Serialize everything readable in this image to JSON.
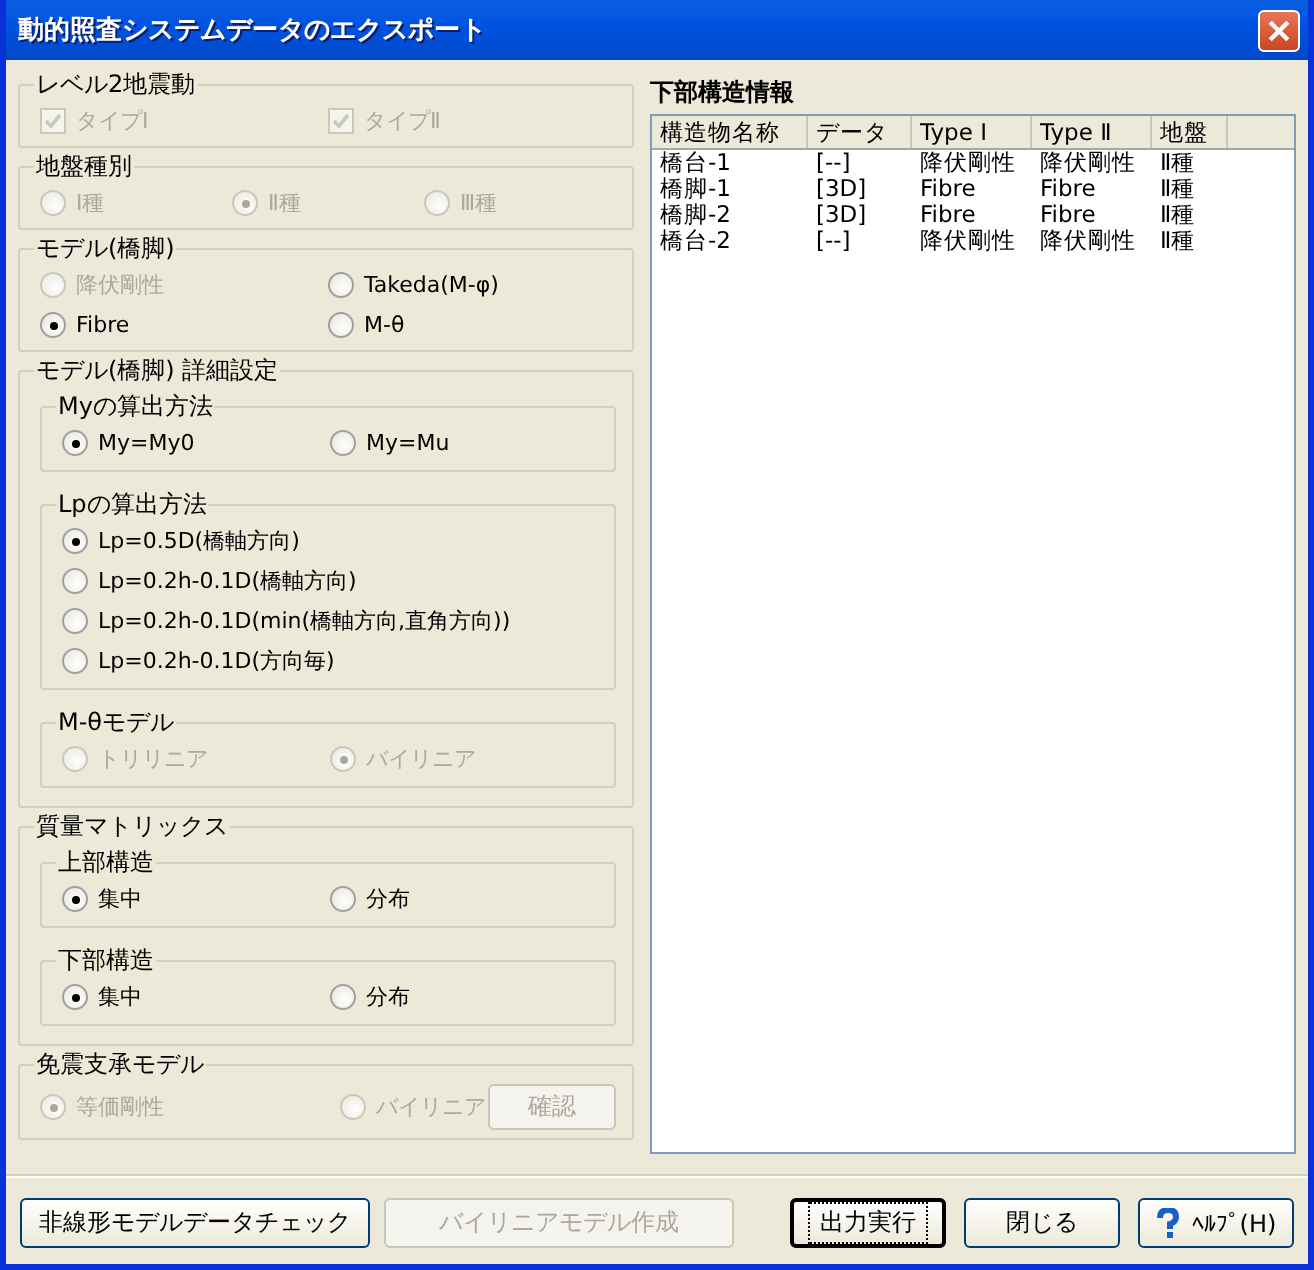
{
  "window": {
    "title": "動的照査システムデータのエクスポート"
  },
  "left_groups": [
    {
      "title": "レベル2地震動",
      "rows": [
        [
          {
            "kind": "checkbox",
            "label": "タイプⅠ",
            "checked": true,
            "disabled": true
          },
          {
            "kind": "checkbox",
            "label": "タイプⅡ",
            "checked": true,
            "disabled": true
          }
        ]
      ]
    },
    {
      "title": "地盤種別",
      "rows": [
        [
          {
            "kind": "radio",
            "label": "Ⅰ種",
            "selected": false,
            "disabled": true
          },
          {
            "kind": "radio",
            "label": "Ⅱ種",
            "selected": true,
            "disabled": true
          },
          {
            "kind": "radio",
            "label": "Ⅲ種",
            "selected": false,
            "disabled": true
          }
        ]
      ]
    },
    {
      "title": "モデル(橋脚)",
      "rows": [
        [
          {
            "kind": "radio",
            "label": "降伏剛性",
            "selected": false,
            "disabled": true
          },
          {
            "kind": "radio",
            "label": "Takeda(M-φ)",
            "selected": false,
            "disabled": false
          }
        ],
        [
          {
            "kind": "radio",
            "label": "Fibre",
            "selected": true,
            "disabled": false
          },
          {
            "kind": "radio",
            "label": "M-θ",
            "selected": false,
            "disabled": false
          }
        ]
      ]
    },
    {
      "title": "モデル(橋脚) 詳細設定",
      "groups": [
        {
          "title": "Myの算出方法",
          "rows": [
            [
              {
                "kind": "radio",
                "label": "My=My0",
                "selected": true,
                "disabled": false
              },
              {
                "kind": "radio",
                "label": "My=Mu",
                "selected": false,
                "disabled": false
              }
            ]
          ]
        },
        {
          "title": "Lpの算出方法",
          "rows": [
            [
              {
                "kind": "radio",
                "label": "Lp=0.5D(橋軸方向)",
                "selected": true,
                "disabled": false
              }
            ],
            [
              {
                "kind": "radio",
                "label": "Lp=0.2h-0.1D(橋軸方向)",
                "selected": false,
                "disabled": false
              }
            ],
            [
              {
                "kind": "radio",
                "label": "Lp=0.2h-0.1D(min(橋軸方向,直角方向))",
                "selected": false,
                "disabled": false
              }
            ],
            [
              {
                "kind": "radio",
                "label": "Lp=0.2h-0.1D(方向毎)",
                "selected": false,
                "disabled": false
              }
            ]
          ]
        },
        {
          "title": "M-θモデル",
          "rows": [
            [
              {
                "kind": "radio",
                "label": "トリリニア",
                "selected": false,
                "disabled": true
              },
              {
                "kind": "radio",
                "label": "バイリニア",
                "selected": true,
                "disabled": true
              }
            ]
          ]
        }
      ]
    },
    {
      "title": "質量マトリックス",
      "groups": [
        {
          "title": "上部構造",
          "rows": [
            [
              {
                "kind": "radio",
                "label": "集中",
                "selected": true,
                "disabled": false
              },
              {
                "kind": "radio",
                "label": "分布",
                "selected": false,
                "disabled": false
              }
            ]
          ]
        },
        {
          "title": "下部構造",
          "rows": [
            [
              {
                "kind": "radio",
                "label": "集中",
                "selected": true,
                "disabled": false
              },
              {
                "kind": "radio",
                "label": "分布",
                "selected": false,
                "disabled": false
              }
            ]
          ]
        }
      ]
    },
    {
      "title": "免震支承モデル",
      "rows": [
        [
          {
            "kind": "radio",
            "label": "等価剛性",
            "selected": true,
            "disabled": true
          },
          {
            "kind": "radio",
            "label": "バイリニア",
            "selected": false,
            "disabled": true
          },
          {
            "kind": "button",
            "label": "確認",
            "disabled": true
          }
        ]
      ]
    }
  ],
  "substructure": {
    "title": "下部構造情報",
    "columns": [
      "構造物名称",
      "データ",
      "Type Ⅰ",
      "Type Ⅱ",
      "地盤"
    ],
    "rows": [
      [
        "橋台-1",
        "[--]",
        "降伏剛性",
        "降伏剛性",
        "Ⅱ種"
      ],
      [
        "橋脚-1",
        "[3D]",
        "Fibre",
        "Fibre",
        "Ⅱ種"
      ],
      [
        "橋脚-2",
        "[3D]",
        "Fibre",
        "Fibre",
        "Ⅱ種"
      ],
      [
        "橋台-2",
        "[--]",
        "降伏剛性",
        "降伏剛性",
        "Ⅱ種"
      ]
    ]
  },
  "footer_left": [
    {
      "label": "非線形モデルデータチェック",
      "disabled": false
    },
    {
      "label": "バイリニアモデル作成",
      "disabled": true
    }
  ],
  "footer_right": [
    {
      "kind": "plain",
      "label": "出力実行",
      "default": true
    },
    {
      "kind": "plain",
      "label": "閉じる",
      "default": false
    },
    {
      "kind": "help",
      "label": "ﾍﾙﾌﾟ(H)",
      "default": false
    }
  ]
}
